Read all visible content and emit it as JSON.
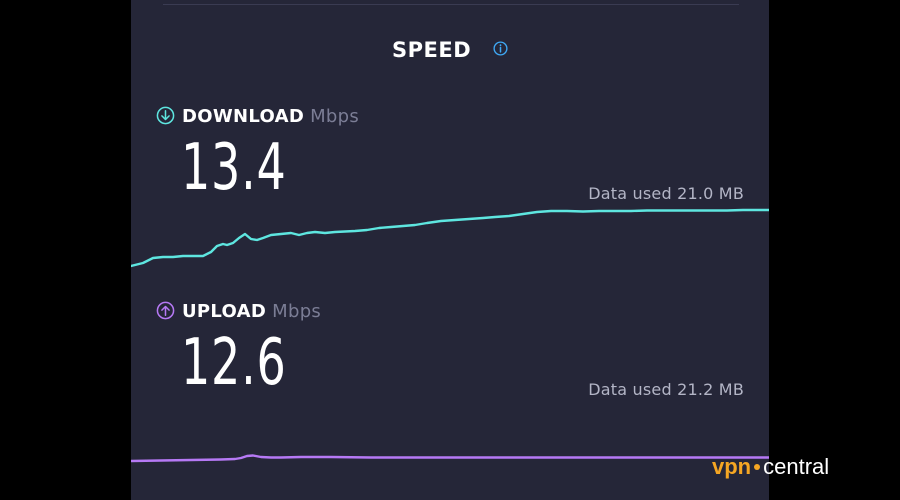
{
  "header": {
    "title": "SPEED",
    "info_icon": "info-icon"
  },
  "download": {
    "icon": "download-arrow-icon",
    "label": "DOWNLOAD",
    "unit": "Mbps",
    "value": "13.4",
    "data_used": "Data used 21.0 MB",
    "color": "#5ee6e0"
  },
  "upload": {
    "icon": "upload-arrow-icon",
    "label": "UPLOAD",
    "unit": "Mbps",
    "value": "12.6",
    "data_used": "Data used 21.2 MB",
    "color": "#b679f5"
  },
  "watermark": {
    "part1": "vpn",
    "part2": "central"
  },
  "colors": {
    "panel_bg": "#252638",
    "info_blue": "#3fa9f5",
    "unit_gray": "#7b7d95"
  }
}
